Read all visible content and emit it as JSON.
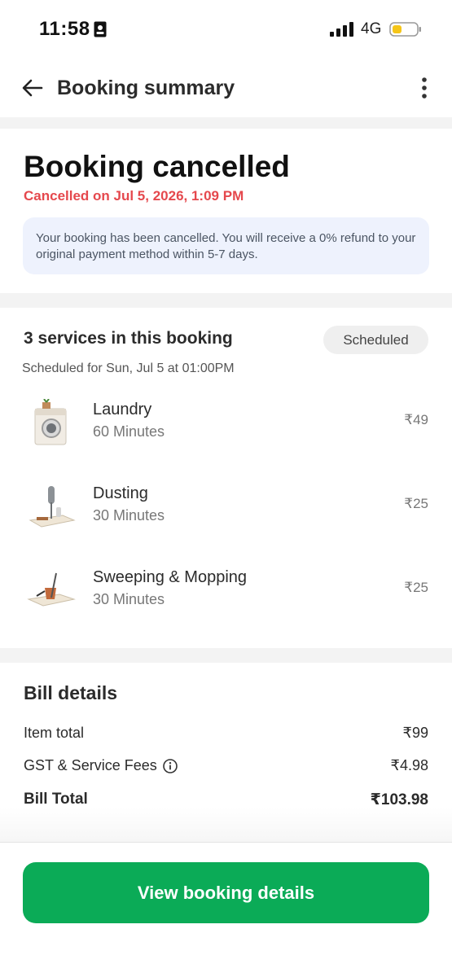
{
  "status_bar": {
    "time": "11:58",
    "network": "4G"
  },
  "header": {
    "title": "Booking summary",
    "back_icon": "arrow-left-icon",
    "more_icon": "more-vertical-icon"
  },
  "cancellation": {
    "title": "Booking cancelled",
    "subtitle": "Cancelled on Jul 5, 2026, 1:09 PM",
    "notice": "Your booking has been cancelled. You will receive a 0% refund to your original payment method within 5-7 days.",
    "accent_color": "#e5484d"
  },
  "services": {
    "heading": "3 services in this booking",
    "status_badge": "Scheduled",
    "schedule": "Scheduled for Sun, Jul 5 at 01:00PM",
    "items": [
      {
        "name": "Laundry",
        "duration": "60 Minutes",
        "price": "₹49",
        "icon": "washing-machine-icon"
      },
      {
        "name": "Dusting",
        "duration": "30 Minutes",
        "price": "₹25",
        "icon": "duster-icon"
      },
      {
        "name": "Sweeping & Mopping",
        "duration": "30 Minutes",
        "price": "₹25",
        "icon": "mop-bucket-icon"
      }
    ]
  },
  "bill": {
    "title": "Bill details",
    "item_total_label": "Item total",
    "item_total": "₹99",
    "fees_label": "GST & Service Fees",
    "fees": "₹4.98",
    "total_label": "Bill Total",
    "total": "₹103.98"
  },
  "cta": {
    "label": "View booking details",
    "color": "#0bab57"
  }
}
